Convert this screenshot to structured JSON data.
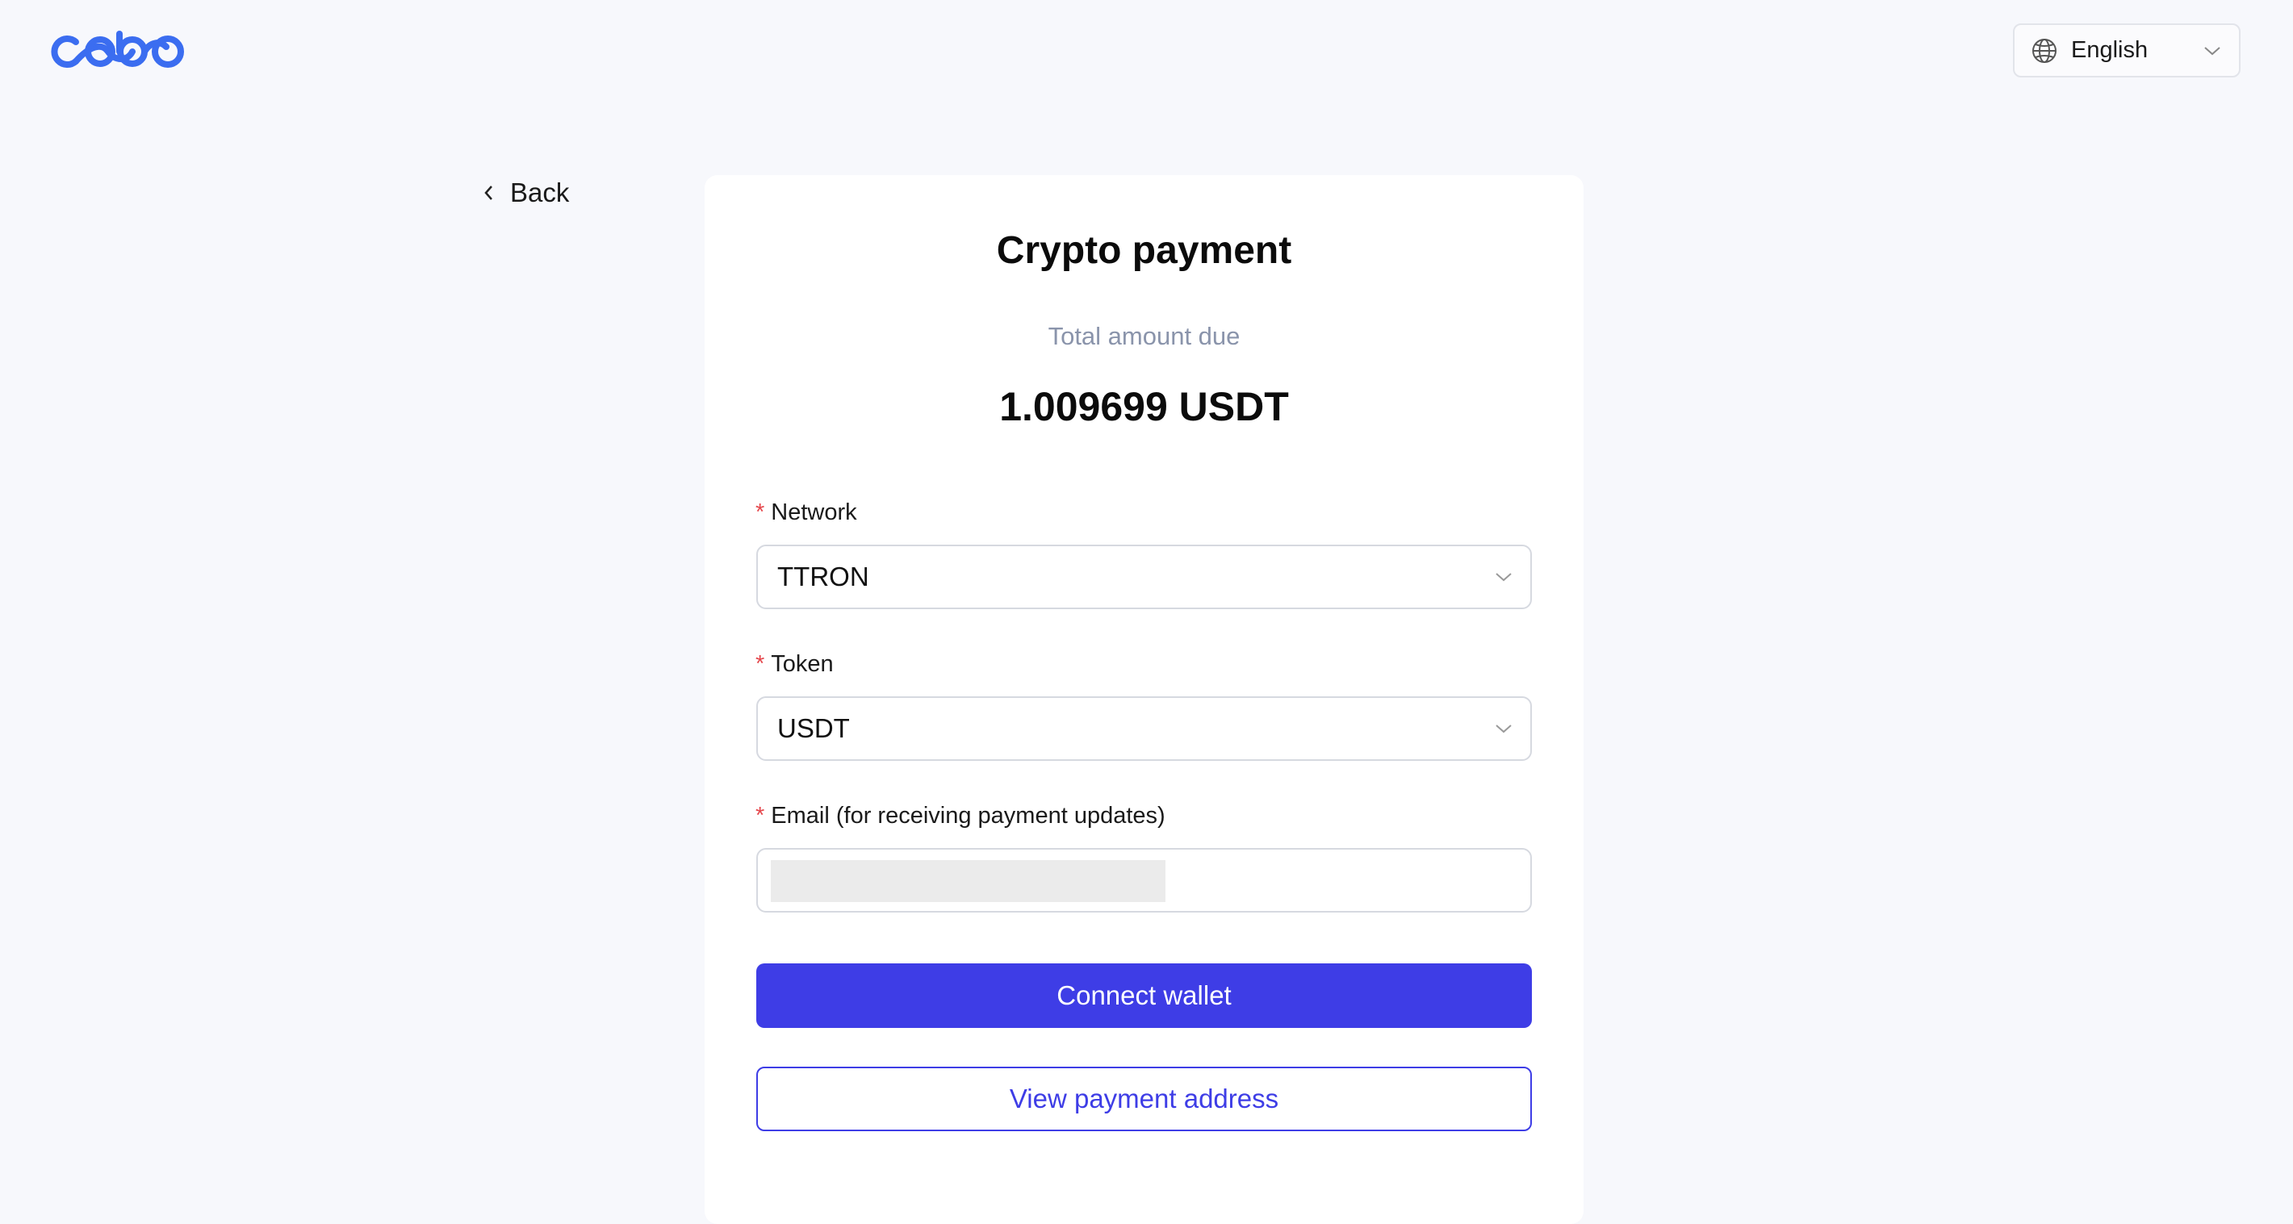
{
  "brand": {
    "logo_icon": "cobo-logo",
    "color": "#3b6df0"
  },
  "header": {
    "language": {
      "icon": "globe-icon",
      "label": "English"
    }
  },
  "nav": {
    "back_label": "Back"
  },
  "payment": {
    "title": "Crypto payment",
    "amount_label": "Total amount due",
    "amount_value": "1.009699 USDT"
  },
  "form": {
    "required_marker": "*",
    "network": {
      "label": "Network",
      "value": "TTRON"
    },
    "token": {
      "label": "Token",
      "value": "USDT"
    },
    "email": {
      "label": "Email (for receiving payment updates)",
      "value": ""
    }
  },
  "actions": {
    "connect_label": "Connect wallet",
    "view_address_label": "View payment address",
    "accent_color": "#3e3de6"
  }
}
